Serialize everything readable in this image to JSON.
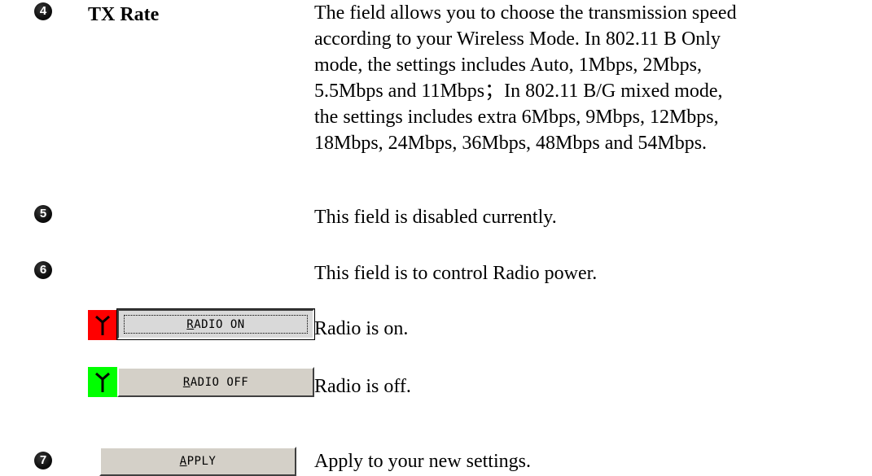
{
  "colors": {
    "radio_on_bg": "#ff0000",
    "radio_off_bg": "#00ff00",
    "button_face": "#d4d0c8",
    "badge": "#111111"
  },
  "items": [
    {
      "number": "4",
      "name": "TX Rate",
      "description_lines": [
        "The field allows you to choose the transmission speed",
        "according to your Wireless Mode. In 802.11 B Only",
        "mode, the settings includes Auto, 1Mbps, 2Mbps,",
        "5.5Mbps and 11Mbps；In 802.11 B/G mixed mode,",
        "the settings includes extra 6Mbps, 9Mbps, 12Mbps,",
        "18Mbps, 24Mbps, 36Mbps, 48Mbps and 54Mbps."
      ]
    },
    {
      "number": "5",
      "description": "This field is disabled currently."
    },
    {
      "number": "6",
      "description": "This field is to control Radio power."
    },
    {
      "number": "7",
      "description": "Apply to your new settings."
    }
  ],
  "radio_on": {
    "icon": "antenna-icon",
    "button_label": "RADIO ON",
    "description": "Radio is on."
  },
  "radio_off": {
    "icon": "antenna-icon",
    "button_label": "RADIO OFF",
    "description": "Radio is off."
  },
  "apply": {
    "button_label": "APPLY"
  }
}
